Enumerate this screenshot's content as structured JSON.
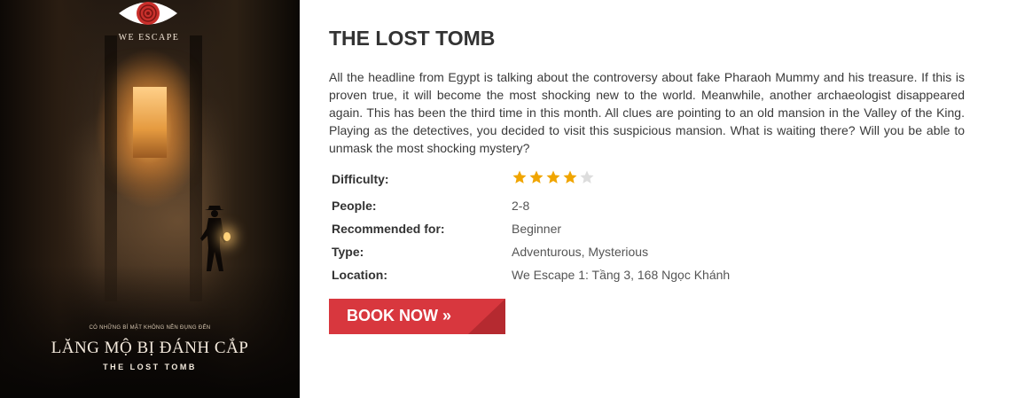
{
  "poster": {
    "brand": "WE ESCAPE",
    "tagline": "CÓ NHỮNG BÍ MẬT KHÔNG NÊN ĐỤNG ĐẾN",
    "title_vn": "LĂNG MỘ BỊ ĐÁNH CẮP",
    "title_en": "THE LOST TOMB"
  },
  "room": {
    "title": "THE LOST TOMB",
    "description": "All the headline from Egypt is talking about the controversy about fake Pharaoh Mummy and his treasure. If this is proven true, it will become the most shocking new to the world. Meanwhile, another archaeologist disappeared again. This has been the third time in this month. All clues are pointing to an old mansion in the Valley of the King. Playing as the detectives, you decided to visit this suspicious mansion. What is waiting there? Will you be able to unmask the most shocking mystery?"
  },
  "info": {
    "difficulty_label": "Difficulty:",
    "difficulty_rating": 4,
    "difficulty_max": 5,
    "people_label": "People:",
    "people_value": "2-8",
    "recommended_label": "Recommended for:",
    "recommended_value": "Beginner",
    "type_label": "Type:",
    "type_value": "Adventurous, Mysterious",
    "location_label": "Location:",
    "location_value": "We Escape 1: Tầng 3, 168 Ngọc Khánh"
  },
  "actions": {
    "book_label": "BOOK NOW »"
  },
  "colors": {
    "star_filled": "#f0a500",
    "star_empty": "#dddddd",
    "button": "#d8373e",
    "button_corner": "#b52a30"
  }
}
